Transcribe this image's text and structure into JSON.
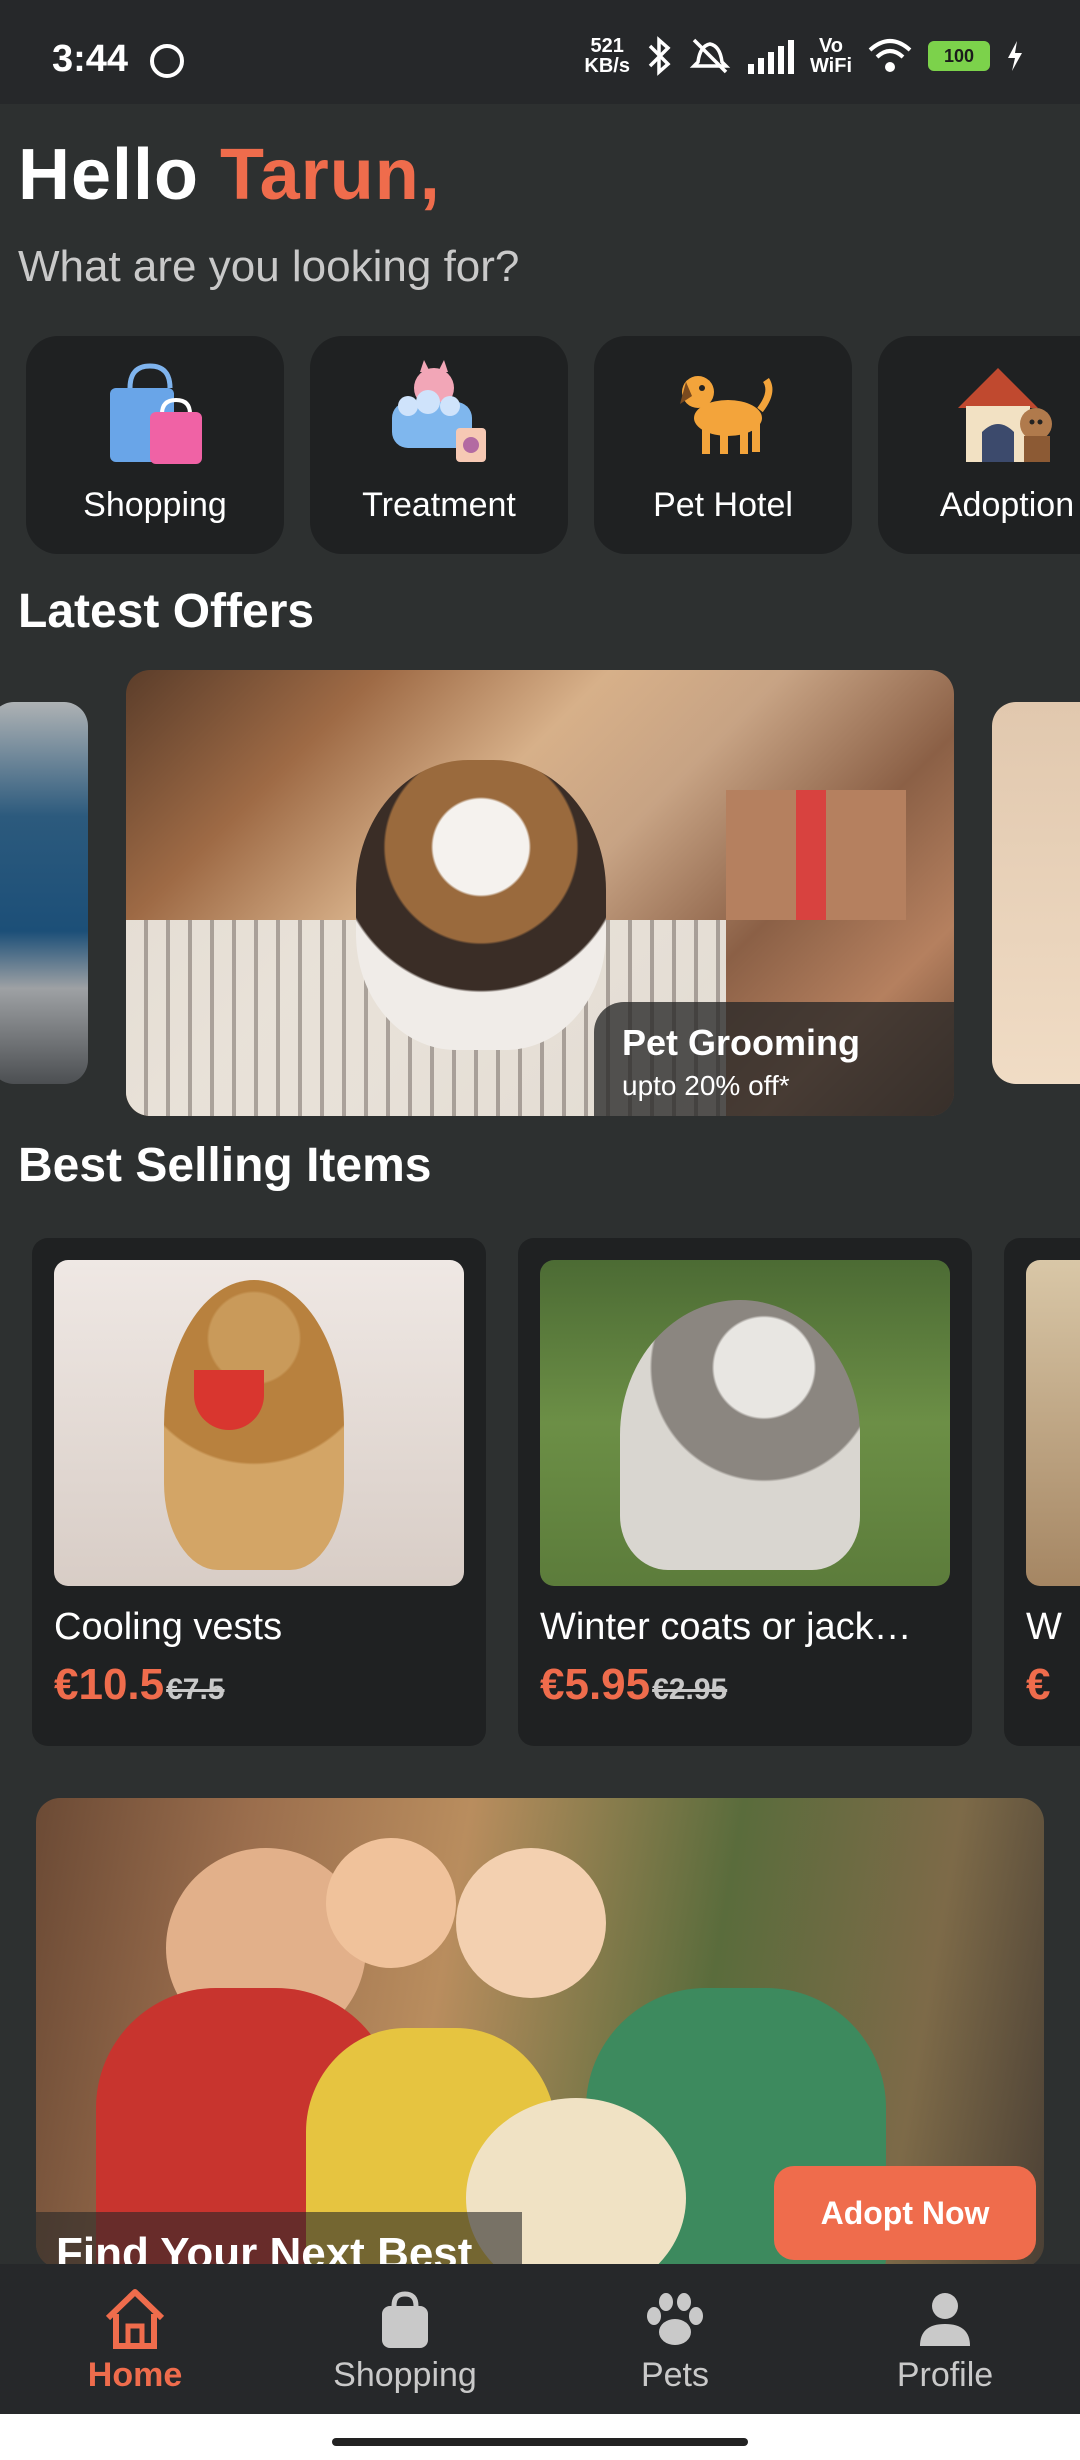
{
  "status_bar": {
    "time": "3:44",
    "net_speed_value": "521",
    "net_speed_unit": "KB/s",
    "vowifi_top": "Vo",
    "vowifi_bottom": "WiFi",
    "battery": "100"
  },
  "greeting": {
    "hello": "Hello",
    "name": "Tarun,",
    "subtitle": "What are you looking for?"
  },
  "categories": [
    {
      "label": "Shopping",
      "icon": "shopping-bags-icon"
    },
    {
      "label": "Treatment",
      "icon": "pet-bath-icon"
    },
    {
      "label": "Pet Hotel",
      "icon": "dog-icon"
    },
    {
      "label": "Adoption",
      "icon": "dog-house-icon"
    }
  ],
  "offers": {
    "title": "Latest Offers",
    "main": {
      "title": "Pet Grooming",
      "subtitle": "upto 20% off*"
    }
  },
  "best_selling": {
    "title": "Best Selling Items",
    "items": [
      {
        "title": "Cooling vests",
        "price": "€10.5",
        "old_price": "€7.5"
      },
      {
        "title": "Winter coats or jack…",
        "price": "€5.95",
        "old_price": "€2.95"
      },
      {
        "title": "W",
        "price": "€"
      }
    ]
  },
  "adoption_banner": {
    "title": "Find Your Next Best Friend",
    "button": "Adopt Now"
  },
  "bottom_nav": [
    {
      "label": "Home",
      "icon": "home-icon",
      "active": true
    },
    {
      "label": "Shopping",
      "icon": "shopping-bag-icon",
      "active": false
    },
    {
      "label": "Pets",
      "icon": "paw-icon",
      "active": false
    },
    {
      "label": "Profile",
      "icon": "person-icon",
      "active": false
    }
  ],
  "colors": {
    "accent": "#ef6c4c",
    "background": "#2d3030",
    "card": "#1f2122"
  }
}
